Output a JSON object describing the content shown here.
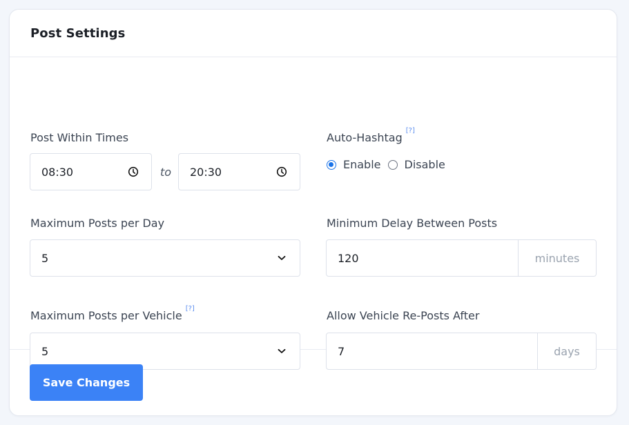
{
  "card": {
    "title": "Post Settings"
  },
  "post_within_times": {
    "label": "Post Within Times",
    "start": "08:30",
    "separator": "to",
    "end": "20:30",
    "icon": "clock-icon"
  },
  "auto_hashtag": {
    "label": "Auto-Hashtag",
    "help": "[?]",
    "options": [
      {
        "label": "Enable",
        "checked": true
      },
      {
        "label": "Disable",
        "checked": false
      }
    ]
  },
  "max_posts_per_day": {
    "label": "Maximum Posts per Day",
    "value": "5",
    "icon": "chevron-down-icon"
  },
  "min_delay": {
    "label": "Minimum Delay Between Posts",
    "value": "120",
    "unit": "minutes"
  },
  "max_posts_per_vehicle": {
    "label": "Maximum Posts per Vehicle",
    "help": "[?]",
    "value": "5",
    "icon": "chevron-down-icon"
  },
  "repost_after": {
    "label": "Allow Vehicle Re-Posts After",
    "value": "7",
    "unit": "days"
  },
  "footer": {
    "save_label": "Save Changes"
  },
  "colors": {
    "accent": "#3b82f6",
    "radio_checked": "#1a73e8",
    "help_link": "#5b8def"
  }
}
